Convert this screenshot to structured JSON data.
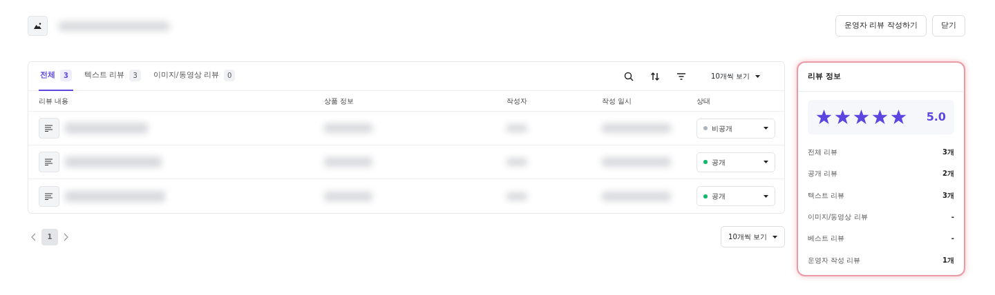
{
  "header": {
    "buttons": [
      {
        "label": "운영자 리뷰 작성하기"
      },
      {
        "label": "닫기"
      }
    ]
  },
  "tabs": [
    {
      "label": "전체",
      "count": "3",
      "selected": true
    },
    {
      "label": "텍스트 리뷰",
      "count": "3",
      "selected": false
    },
    {
      "label": "이미지/동영상 리뷰",
      "count": "0",
      "selected": false
    }
  ],
  "toolbar": {
    "page_size": "10개씩 보기"
  },
  "table": {
    "columns": [
      "리뷰 내용",
      "상품 정보",
      "작성자",
      "작성 일시",
      "상태"
    ],
    "rows": [
      {
        "status": "비공개",
        "color": "#adb5bd"
      },
      {
        "status": "공개",
        "color": "#12b76a"
      },
      {
        "status": "공개",
        "color": "#12b76a"
      }
    ]
  },
  "pagination": {
    "pages": [
      {
        "label": "1",
        "selected": true
      }
    ],
    "page_size": "10개씩 보기"
  },
  "summary": {
    "title": "리뷰 정보",
    "stars": 5,
    "score": "5.0",
    "stats": [
      {
        "label": "전체 리뷰",
        "value": "3개"
      },
      {
        "label": "공개 리뷰",
        "value": "2개"
      },
      {
        "label": "텍스트 리뷰",
        "value": "3개"
      },
      {
        "label": "이미지/동영상 리뷰",
        "value": "-"
      },
      {
        "label": "베스트 리뷰",
        "value": "-"
      },
      {
        "label": "운영자 작성 리뷰",
        "value": "1개"
      }
    ]
  }
}
